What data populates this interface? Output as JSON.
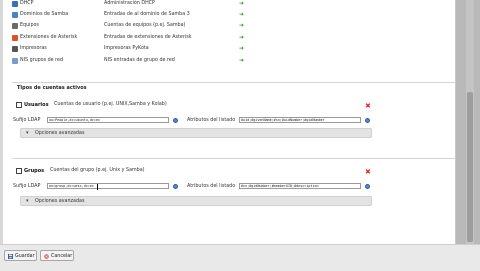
{
  "plugins": [
    {
      "name": "DHCP",
      "desc": "Administración DHCP",
      "icon_color": "#3b6fb6"
    },
    {
      "name": "Dominios de Samba",
      "desc": "Entradas de al dominio de Samba 3",
      "icon_color": "#4d7fc3"
    },
    {
      "name": "Equipos",
      "desc": "Cuentas de equipos (p.ej. Samba)",
      "icon_color": "#6a6a6a"
    },
    {
      "name": "Extensiones de Asterisk",
      "desc": "Entradas de extensiones de Asterisk",
      "icon_color": "#d9542b"
    },
    {
      "name": "Impresoras",
      "desc": "Impresoras PyKota",
      "icon_color": "#555555"
    },
    {
      "name": "NIS grupos de red",
      "desc": "NIS entradas de grupo de red",
      "icon_color": "#7a9ccc"
    }
  ],
  "add_arrow": "➜",
  "section_title": "Tipos de cuentas activos",
  "accounts": {
    "users": {
      "name": "Usuarios",
      "desc": "Cuentas de usuario (p.ej. UNIX,Samba y Kolab)",
      "suffix_label": "Sufijo LDAP",
      "suffix_value": "ou=People,dc=ubuntu,dc=ec",
      "attr_label": "Atributos del listado",
      "attr_value": "#uid;#givenName;#sn;#uidNumber;#gidNumber",
      "advanced_label": "Opciones avanzadas",
      "remove_symbol": "✖"
    },
    "groups": {
      "name": "Grupos",
      "desc": "Cuentas del grupo (p.ej. Unix y Samba)",
      "suffix_label": "Sufijo LDAP",
      "suffix_value": "ou=group,dc=uesc,dc=ec",
      "attr_label": "Atributos del listado",
      "attr_value": "#cn;#gidNumber;#memberUID;#description",
      "advanced_label": "Opciones avanzadas",
      "remove_symbol": "✖"
    }
  },
  "buttons": {
    "save": "Guardar",
    "cancel": "Cancelar"
  },
  "colors": {
    "accent_blue": "#5b86c7",
    "add_green": "#3a9a2b",
    "remove_red": "#d33333"
  }
}
